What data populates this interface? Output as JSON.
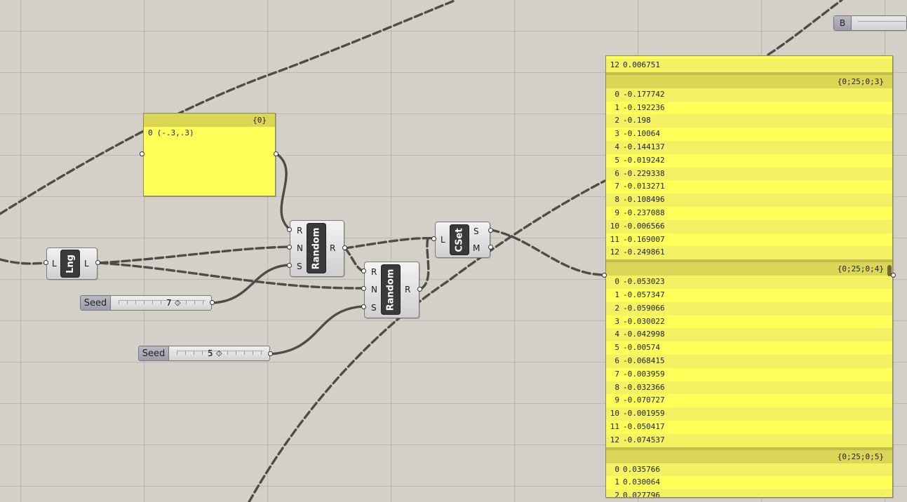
{
  "panel_small": {
    "header": "{0}",
    "rows": [
      {
        "index": "0",
        "value": "(-.3,.3)"
      }
    ]
  },
  "lng_component": {
    "label": "Lng",
    "input": "L",
    "output": "L"
  },
  "random_top": {
    "label": "Random",
    "inputs": [
      "R",
      "N",
      "S"
    ],
    "output": "R"
  },
  "random_bottom": {
    "label": "Random",
    "inputs": [
      "R",
      "N",
      "S"
    ],
    "output": "R"
  },
  "cset_component": {
    "label": "CSet",
    "input": "L",
    "outputs": [
      "S",
      "M"
    ]
  },
  "seed_slider_top": {
    "label": "Seed",
    "value": "7",
    "knob": "◇"
  },
  "seed_slider_bottom": {
    "label": "Seed",
    "value": "5",
    "knob": "◇"
  },
  "boolean_node": {
    "label": "B"
  },
  "panel_large": {
    "groups": [
      {
        "header": "",
        "rows": [
          {
            "index": "12",
            "value": "0.006751"
          }
        ]
      },
      {
        "header": "{0;25;0;3}",
        "rows": [
          {
            "index": "0",
            "value": "-0.177742"
          },
          {
            "index": "1",
            "value": "-0.192236"
          },
          {
            "index": "2",
            "value": "-0.198"
          },
          {
            "index": "3",
            "value": "-0.10064"
          },
          {
            "index": "4",
            "value": "-0.144137"
          },
          {
            "index": "5",
            "value": "-0.019242"
          },
          {
            "index": "6",
            "value": "-0.229338"
          },
          {
            "index": "7",
            "value": "-0.013271"
          },
          {
            "index": "8",
            "value": "-0.108496"
          },
          {
            "index": "9",
            "value": "-0.237088"
          },
          {
            "index": "10",
            "value": "-0.006566"
          },
          {
            "index": "11",
            "value": "-0.169007"
          },
          {
            "index": "12",
            "value": "-0.249861"
          }
        ]
      },
      {
        "header": "{0;25;0;4}",
        "rows": [
          {
            "index": "0",
            "value": "-0.053023"
          },
          {
            "index": "1",
            "value": "-0.057347"
          },
          {
            "index": "2",
            "value": "-0.059066"
          },
          {
            "index": "3",
            "value": "-0.030022"
          },
          {
            "index": "4",
            "value": "-0.042998"
          },
          {
            "index": "5",
            "value": "-0.00574"
          },
          {
            "index": "6",
            "value": "-0.068415"
          },
          {
            "index": "7",
            "value": "-0.003959"
          },
          {
            "index": "8",
            "value": "-0.032366"
          },
          {
            "index": "9",
            "value": "-0.070727"
          },
          {
            "index": "10",
            "value": "-0.001959"
          },
          {
            "index": "11",
            "value": "-0.050417"
          },
          {
            "index": "12",
            "value": "-0.074537"
          }
        ]
      },
      {
        "header": "{0;25;0;5}",
        "rows": [
          {
            "index": "0",
            "value": "0.035766"
          },
          {
            "index": "1",
            "value": "0.030064"
          },
          {
            "index": "2",
            "value": "0.027796"
          }
        ]
      }
    ]
  }
}
